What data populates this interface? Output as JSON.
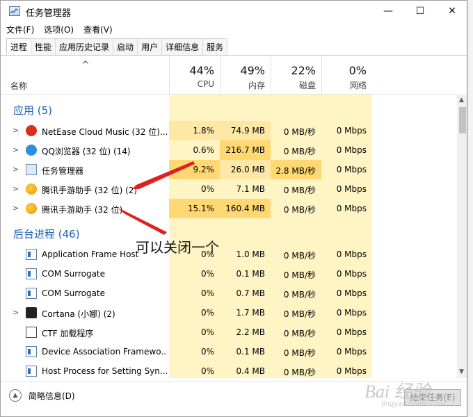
{
  "window": {
    "title": "任务管理器",
    "controls": {
      "minimize": "—",
      "maximize": "☐",
      "close": "✕"
    }
  },
  "menu": [
    "文件(F)",
    "选项(O)",
    "查看(V)"
  ],
  "tabs": [
    "进程",
    "性能",
    "应用历史记录",
    "启动",
    "用户",
    "详细信息",
    "服务"
  ],
  "header": {
    "name_label": "名称",
    "sort_arrow": "^",
    "cpu": {
      "percent": "44%",
      "label": "CPU"
    },
    "memory": {
      "percent": "49%",
      "label": "内存"
    },
    "disk": {
      "percent": "22%",
      "label": "磁盘"
    },
    "network": {
      "percent": "0%",
      "label": "网络"
    }
  },
  "sections": {
    "apps": "应用 (5)",
    "background": "后台进程 (46)"
  },
  "apps": [
    {
      "name": "NetEase Cloud Music (32 位)...",
      "cpu": "1.8%",
      "mem": "74.9 MB",
      "disk": "0 MB/秒",
      "net": "0 Mbps",
      "icon": "netease-music-icon"
    },
    {
      "name": "QQ浏览器 (32 位) (14)",
      "cpu": "0.6%",
      "mem": "216.7 MB",
      "disk": "0 MB/秒",
      "net": "0 Mbps",
      "icon": "qq-browser-icon"
    },
    {
      "name": "任务管理器",
      "cpu": "9.2%",
      "mem": "26.0 MB",
      "disk": "2.8 MB/秒",
      "net": "0 Mbps",
      "icon": "task-manager-icon"
    },
    {
      "name": "腾讯手游助手 (32 位) (2)",
      "cpu": "0%",
      "mem": "7.1 MB",
      "disk": "0 MB/秒",
      "net": "0 Mbps",
      "icon": "tencent-gameassist-icon"
    },
    {
      "name": "腾讯手游助手 (32 位)",
      "cpu": "15.1%",
      "mem": "160.4 MB",
      "disk": "0 MB/秒",
      "net": "0 Mbps",
      "icon": "tencent-gameassist-icon"
    }
  ],
  "background": [
    {
      "name": "Application Frame Host",
      "cpu": "0%",
      "mem": "1.0 MB",
      "disk": "0 MB/秒",
      "net": "0 Mbps",
      "icon": "app-window-icon"
    },
    {
      "name": "COM Surrogate",
      "cpu": "0%",
      "mem": "0.1 MB",
      "disk": "0 MB/秒",
      "net": "0 Mbps",
      "icon": "app-window-icon"
    },
    {
      "name": "COM Surrogate",
      "cpu": "0%",
      "mem": "0.7 MB",
      "disk": "0 MB/秒",
      "net": "0 Mbps",
      "icon": "app-window-icon"
    },
    {
      "name": "Cortana (小娜) (2)",
      "cpu": "0%",
      "mem": "1.7 MB",
      "disk": "0 MB/秒",
      "net": "0 Mbps",
      "icon": "cortana-icon"
    },
    {
      "name": "CTF 加载程序",
      "cpu": "0%",
      "mem": "2.2 MB",
      "disk": "0 MB/秒",
      "net": "0 Mbps",
      "icon": "ctf-loader-icon"
    },
    {
      "name": "Device Association Framewo...",
      "cpu": "0%",
      "mem": "0.1 MB",
      "disk": "0 MB/秒",
      "net": "0 Mbps",
      "icon": "app-window-icon"
    },
    {
      "name": "Host Process for Setting Syn...",
      "cpu": "0%",
      "mem": "0.4 MB",
      "disk": "0 MB/秒",
      "net": "0 Mbps",
      "icon": "app-window-icon"
    }
  ],
  "footer": {
    "fewer_details": "简略信息(D)",
    "end_task": "结束任务(E)"
  },
  "annotation": "可以关闭一个",
  "watermark": {
    "brand": "Bai 经验",
    "url": "jingyan.baidu.com"
  },
  "colors": {
    "accent": "#1a5fb4",
    "cell_bg": "#fff4c4",
    "cell_hi": "#ffd873",
    "arrow": "#e02020"
  }
}
